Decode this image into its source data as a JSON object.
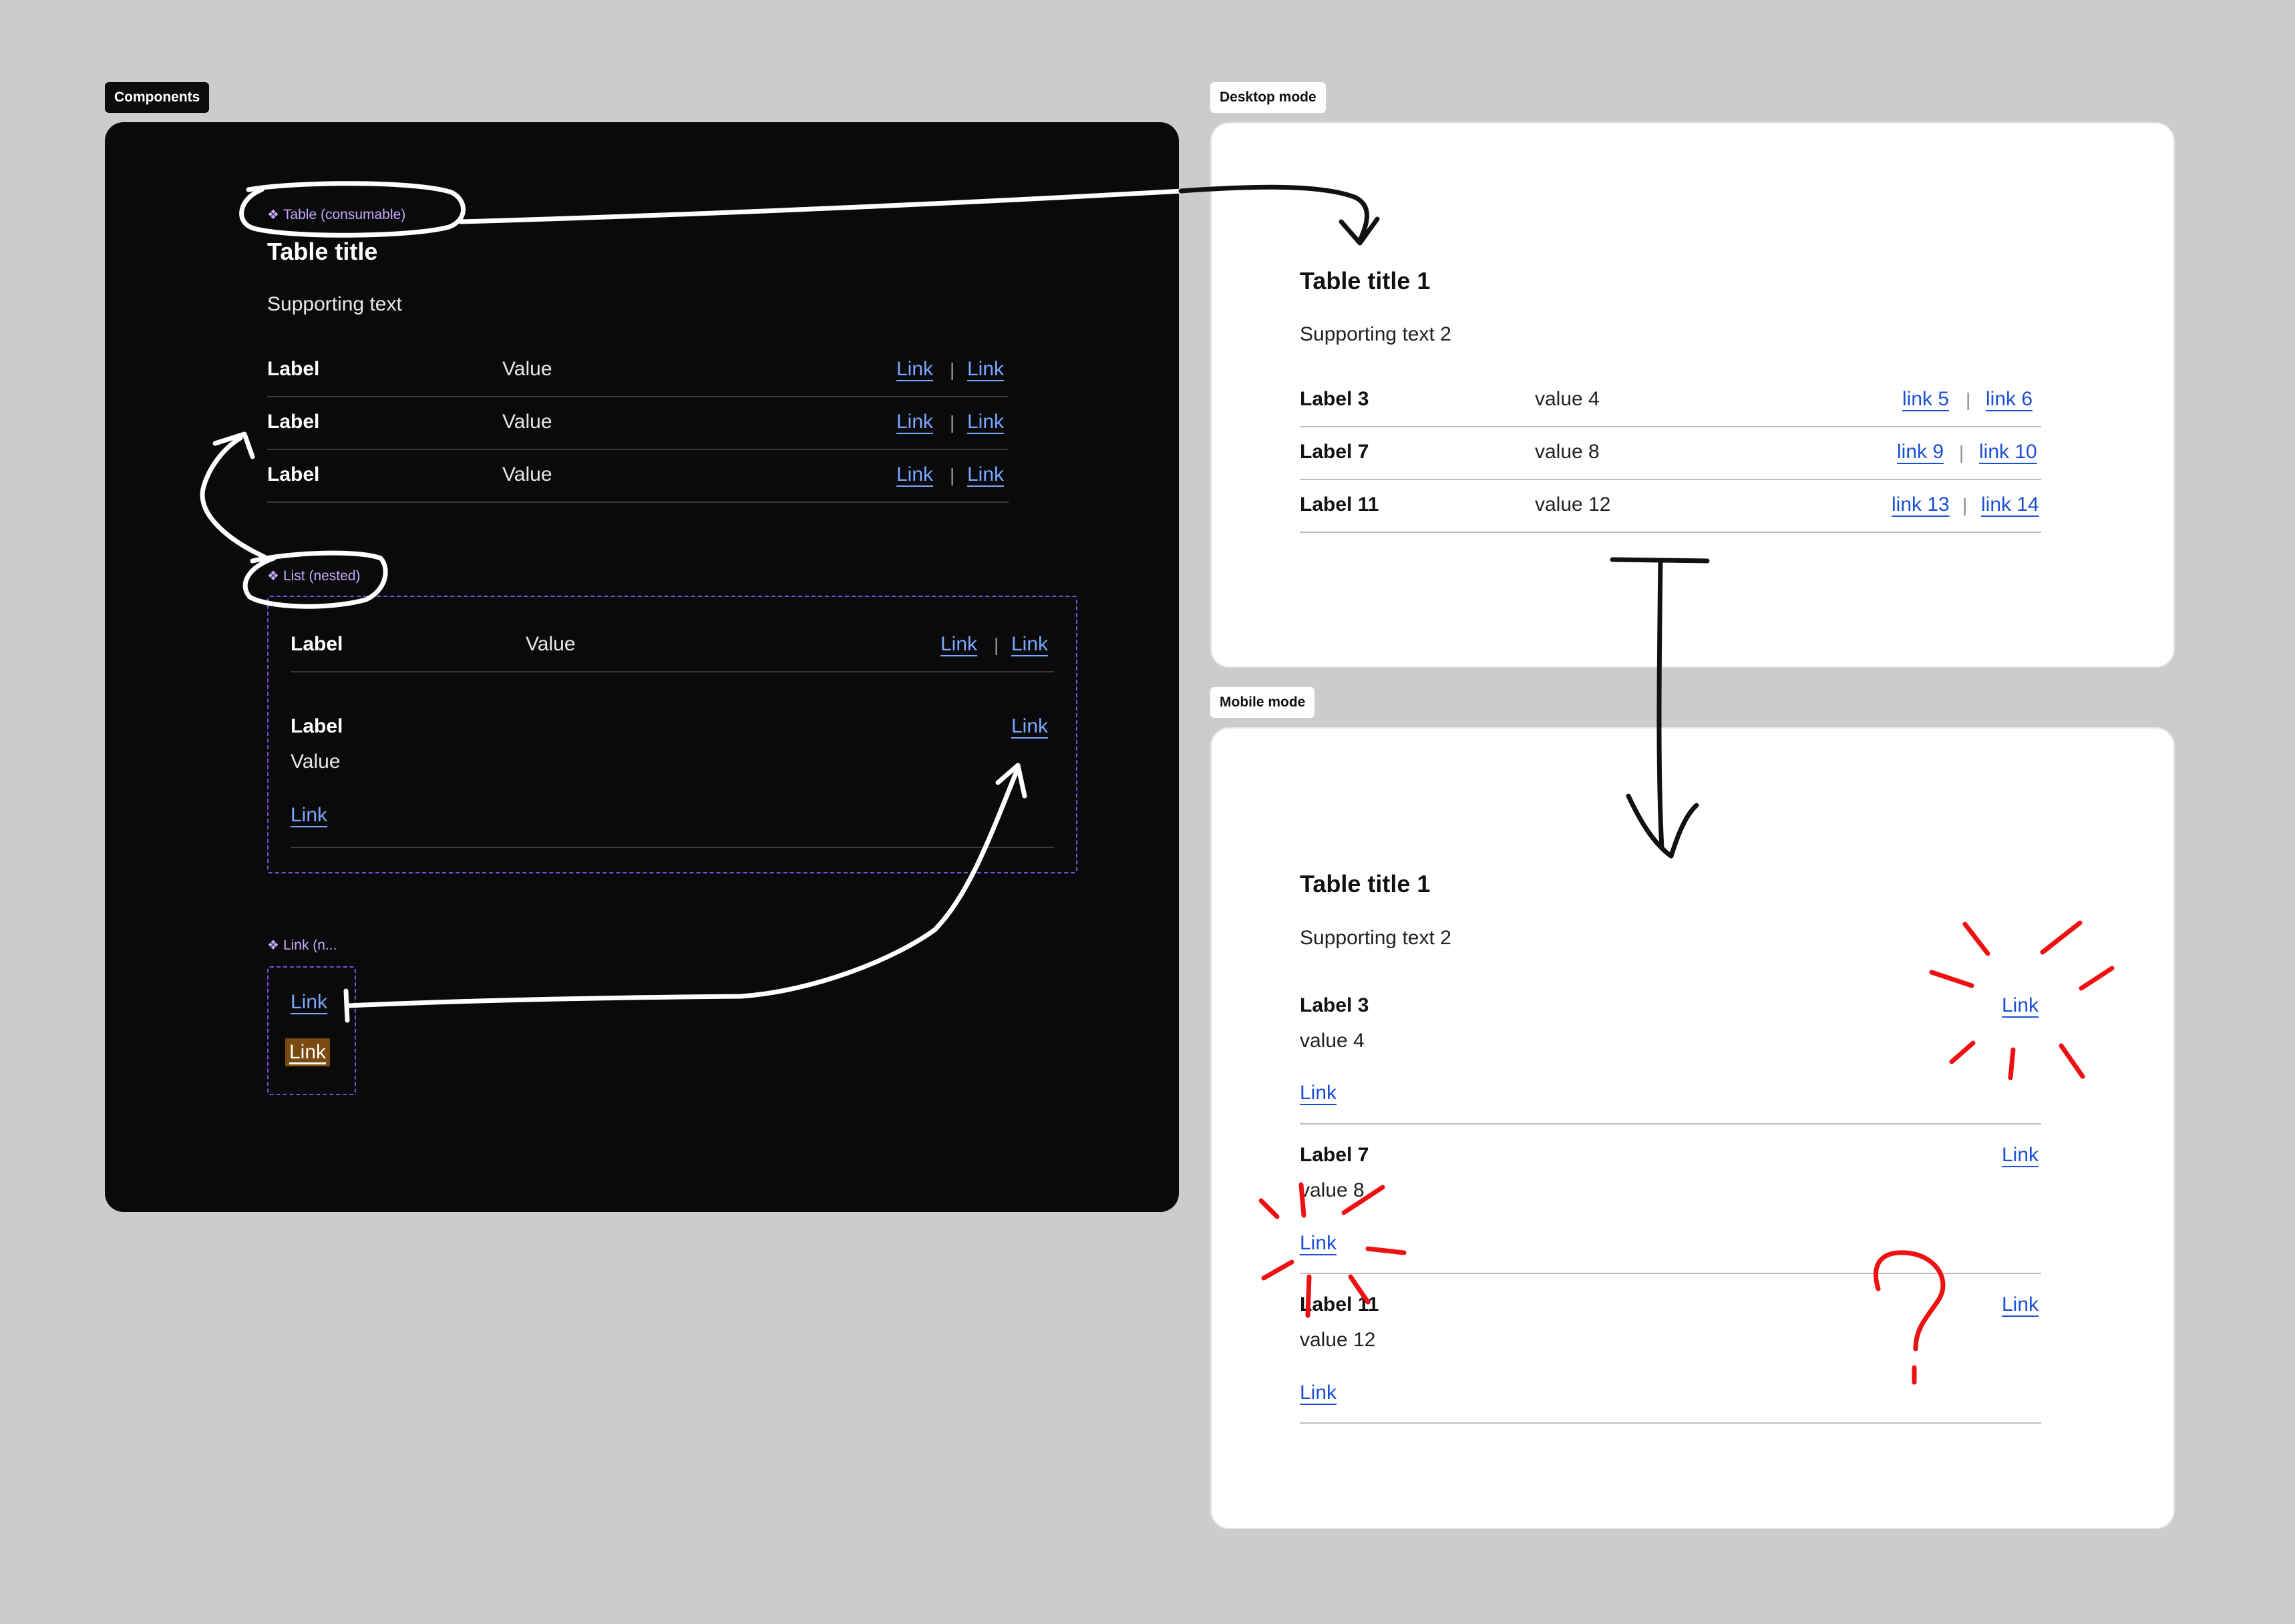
{
  "frames": {
    "components_tag": "Components",
    "desktop_tag": "Desktop mode",
    "mobile_tag": "Mobile mode"
  },
  "components": {
    "table_tag": "Table (consumable)",
    "table_title": "Table title",
    "supporting": "Supporting text",
    "rows": [
      {
        "label": "Label",
        "value": "Value",
        "link1": "Link",
        "sep": "|",
        "link2": "Link"
      },
      {
        "label": "Label",
        "value": "Value",
        "link1": "Link",
        "sep": "|",
        "link2": "Link"
      },
      {
        "label": "Label",
        "value": "Value",
        "link1": "Link",
        "sep": "|",
        "link2": "Link"
      }
    ],
    "list_tag": "List (nested)",
    "list": {
      "row1": {
        "label": "Label",
        "value": "Value",
        "link1": "Link",
        "sep": "|",
        "link2": "Link"
      },
      "row2": {
        "label": "Label",
        "value": "Value",
        "link_right": "Link",
        "link_bottom": "Link"
      }
    },
    "link_tag": "Link (n...",
    "link_default": "Link",
    "link_hover": "Link"
  },
  "desktop": {
    "title": "Table title 1",
    "supporting": "Supporting text 2",
    "rows": [
      {
        "label": "Label 3",
        "value": "value 4",
        "link1": "link 5",
        "sep": "|",
        "link2": "link 6"
      },
      {
        "label": "Label 7",
        "value": "value 8",
        "link1": "link 9",
        "sep": "|",
        "link2": "link 10"
      },
      {
        "label": "Label 11",
        "value": "value 12",
        "link1": "link 13",
        "sep": "|",
        "link2": "link 14"
      }
    ]
  },
  "mobile": {
    "title": "Table title 1",
    "supporting": "Supporting text 2",
    "rows": [
      {
        "label": "Label 3",
        "value": "value 4",
        "link_right": "Link",
        "link_bottom": "Link"
      },
      {
        "label": "Label 7",
        "value": "value 8",
        "link_right": "Link",
        "link_bottom": "Link"
      },
      {
        "label": "Label 11",
        "value": "value 12",
        "link_right": "Link",
        "link_bottom": "Link"
      }
    ]
  },
  "colors": {
    "canvas": "#cccccc",
    "dark_frame": "#0a0a0a",
    "light_frame": "#ffffff",
    "link_dark": "#7aa7ff",
    "link_light": "#1a4fd6",
    "component_tag": "#c7a8ff",
    "dashed_border": "#7a4de0",
    "highlight_bg": "#7a4a10",
    "annotation_red": "#ee1111"
  },
  "icons": {
    "component": "component-diamond-icon"
  }
}
